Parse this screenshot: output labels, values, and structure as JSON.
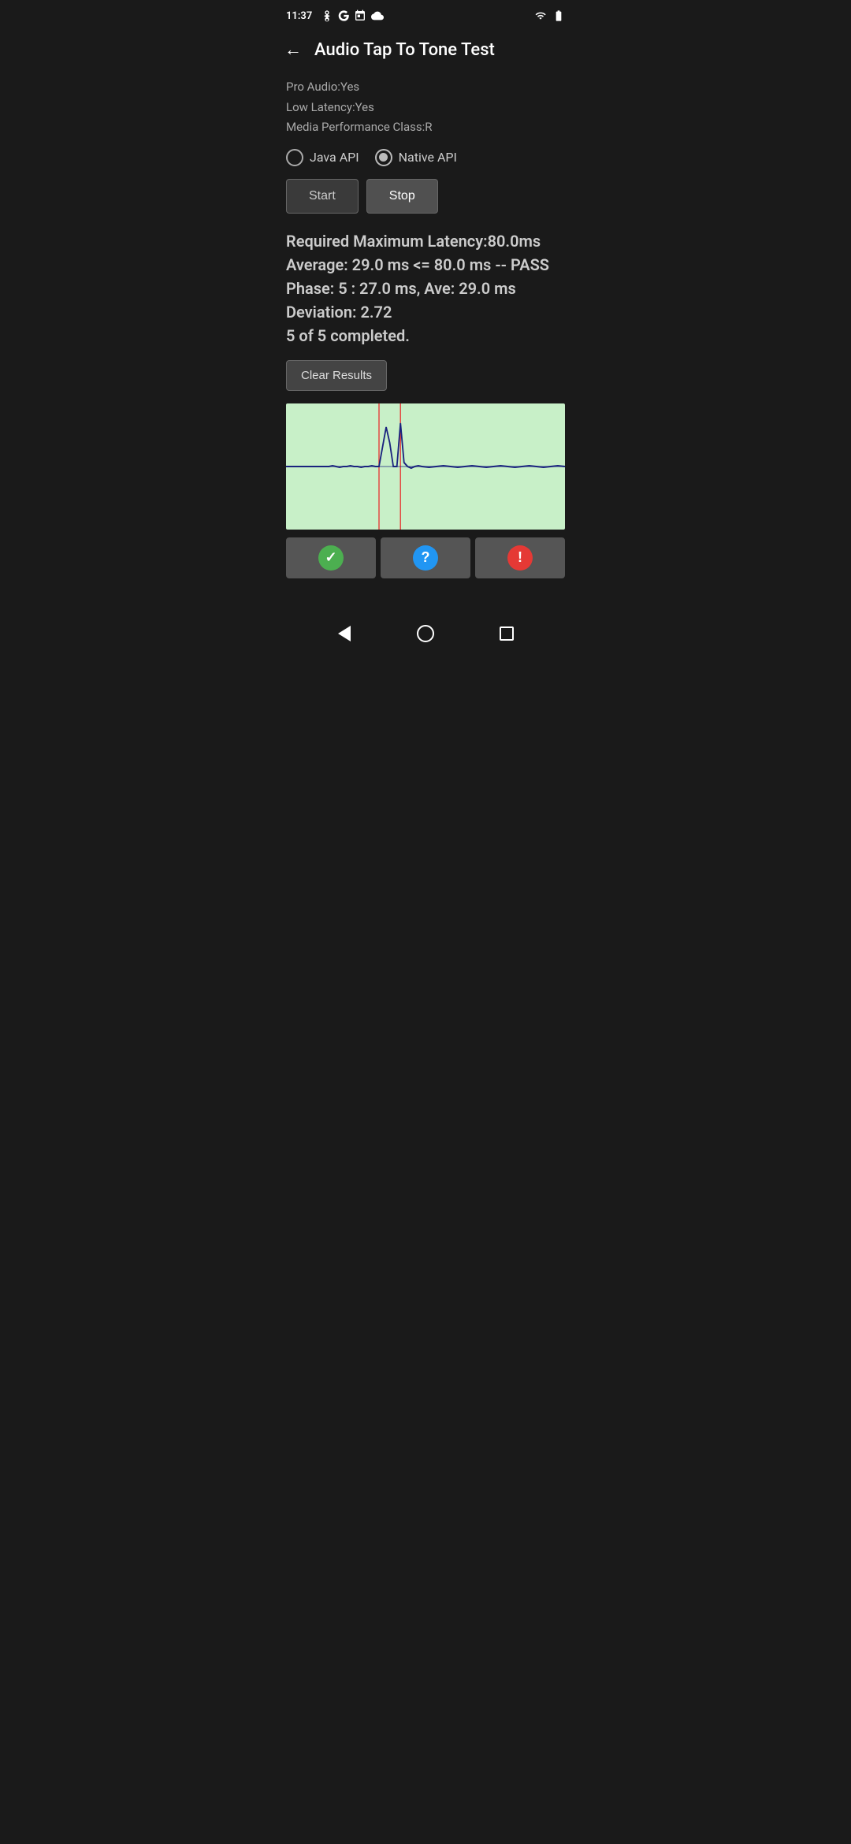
{
  "status_bar": {
    "time": "11:37"
  },
  "header": {
    "title": "Audio Tap To Tone Test",
    "back_label": "back"
  },
  "device_info": {
    "pro_audio": "Pro Audio:Yes",
    "low_latency": "Low Latency:Yes",
    "media_perf": "Media Performance Class:R"
  },
  "api_selection": {
    "java_api_label": "Java API",
    "native_api_label": "Native API",
    "selected": "native"
  },
  "controls": {
    "start_label": "Start",
    "stop_label": "Stop"
  },
  "results": {
    "line1": "Required Maximum Latency:80.0ms",
    "line2": "Average: 29.0 ms <= 80.0 ms -- PASS",
    "line3": "Phase: 5 : 27.0 ms, Ave: 29.0 ms",
    "line4": "Deviation: 2.72",
    "line5": "5 of 5 completed.",
    "clear_label": "Clear Results"
  },
  "action_buttons": {
    "check_icon": "✓",
    "question_icon": "?",
    "warning_icon": "!"
  }
}
